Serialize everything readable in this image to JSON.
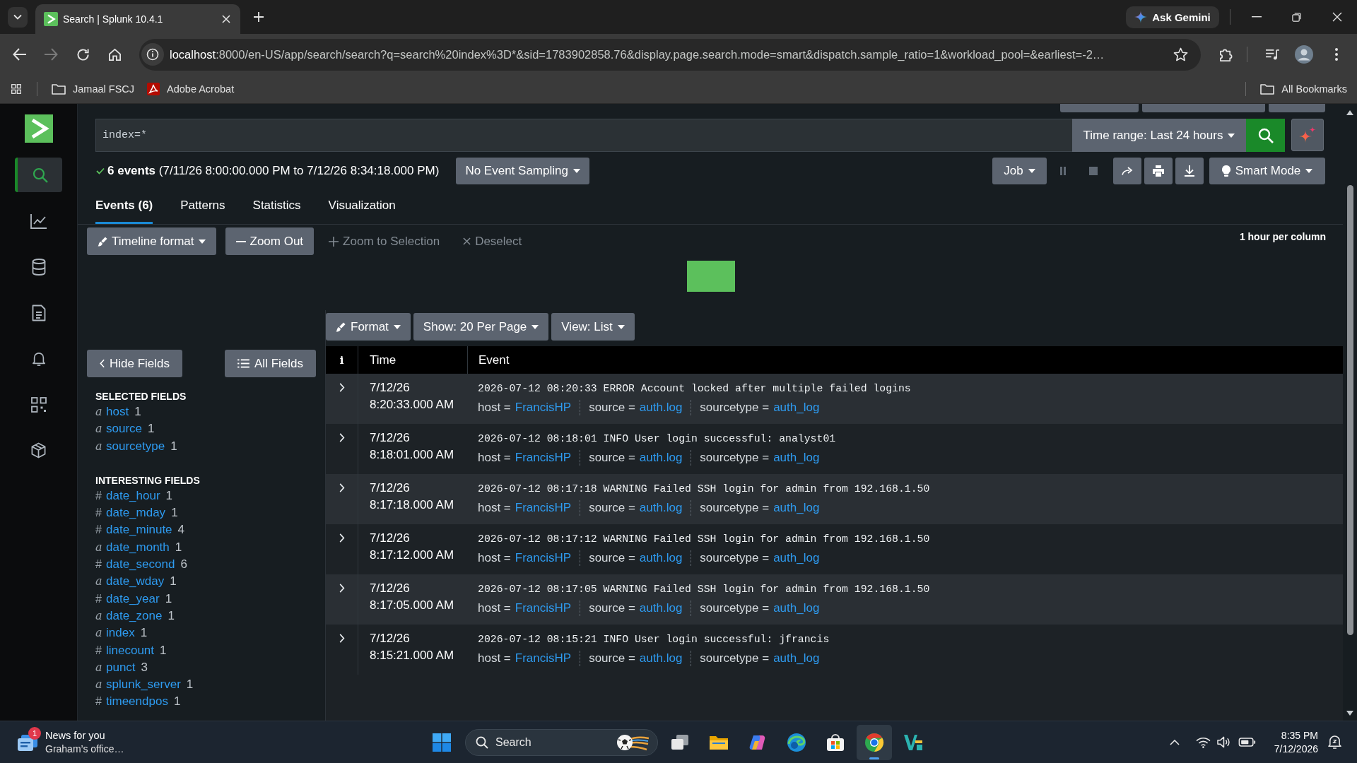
{
  "browser": {
    "tabs": [
      {
        "title": "Search | Splunk 10.4.1",
        "selected": true
      }
    ],
    "gemini": "Ask Gemini",
    "forward": {
      "disabled": true
    },
    "address": {
      "host": "localhost",
      "rest": ":8000/en-US/app/search/search?q=search%20index%3D*&sid=1783902858.76&display.page.search.mode=smart&dispatch.sample_ratio=1&workload_pool=&earliest=-2…"
    },
    "bookmarks": [
      {
        "kind": "folder",
        "label": "Jamaal FSCJ"
      },
      {
        "kind": "acrobat",
        "label": "Adobe Acrobat"
      }
    ],
    "all_bookmarks": "All Bookmarks"
  },
  "splunk": {
    "search": {
      "query": "index=*",
      "time_range": "Time range: Last 24 hours"
    },
    "status": {
      "summary": "**6 events** (7/11/26 8:00:00.000 PM to 7/12/26 8:34:18.000 PM)",
      "sampling": "No Event Sampling"
    },
    "job": {
      "label": "Job",
      "controls": [
        {
          "kind": "pause",
          "disabled": true
        },
        {
          "kind": "stop",
          "disabled": true
        },
        {
          "kind": "share",
          "disabled": false
        },
        {
          "kind": "print",
          "disabled": false
        },
        {
          "kind": "export",
          "disabled": false
        }
      ],
      "mode": "Smart Mode"
    },
    "tabs": [
      {
        "label": "Events (6)",
        "selected": true
      },
      {
        "label": "Patterns",
        "selected": false
      },
      {
        "label": "Statistics",
        "selected": false
      },
      {
        "label": "Visualization",
        "selected": false
      }
    ],
    "timeline": {
      "buttons": [
        {
          "kind": "format",
          "label": "Timeline format",
          "dropdown": true,
          "disabled": false
        },
        {
          "kind": "zoom_out",
          "label": "Zoom Out",
          "dropdown": false,
          "disabled": false
        },
        {
          "kind": "zoom_in",
          "label": "Zoom to Selection",
          "dropdown": false,
          "disabled": true
        },
        {
          "kind": "deselect",
          "label": "Deselect",
          "dropdown": false,
          "disabled": true
        }
      ],
      "scale": "1 hour per column"
    },
    "results_controls": [
      {
        "kind": "format",
        "label": "Format",
        "dropdown": true
      },
      {
        "kind": "count",
        "label": "Show: 20 Per Page",
        "dropdown": true
      },
      {
        "kind": "view",
        "label": "View: List",
        "dropdown": true
      }
    ],
    "fields": {
      "hide": "Hide Fields",
      "all": "All Fields",
      "sections": [
        {
          "title": "SELECTED FIELDS",
          "items": [
            {
              "kind": "string",
              "glyph": "a",
              "name": "host",
              "count": "1"
            },
            {
              "kind": "string",
              "glyph": "a",
              "name": "source",
              "count": "1"
            },
            {
              "kind": "string",
              "glyph": "a",
              "name": "sourcetype",
              "count": "1"
            }
          ]
        },
        {
          "title": "INTERESTING FIELDS",
          "items": [
            {
              "kind": "number",
              "glyph": "#",
              "name": "date_hour",
              "count": "1"
            },
            {
              "kind": "number",
              "glyph": "#",
              "name": "date_mday",
              "count": "1"
            },
            {
              "kind": "number",
              "glyph": "#",
              "name": "date_minute",
              "count": "4"
            },
            {
              "kind": "string",
              "glyph": "a",
              "name": "date_month",
              "count": "1"
            },
            {
              "kind": "number",
              "glyph": "#",
              "name": "date_second",
              "count": "6"
            },
            {
              "kind": "string",
              "glyph": "a",
              "name": "date_wday",
              "count": "1"
            },
            {
              "kind": "number",
              "glyph": "#",
              "name": "date_year",
              "count": "1"
            },
            {
              "kind": "string",
              "glyph": "a",
              "name": "date_zone",
              "count": "1"
            },
            {
              "kind": "string",
              "glyph": "a",
              "name": "index",
              "count": "1"
            },
            {
              "kind": "number",
              "glyph": "#",
              "name": "linecount",
              "count": "1"
            },
            {
              "kind": "string",
              "glyph": "a",
              "name": "punct",
              "count": "3"
            },
            {
              "kind": "string",
              "glyph": "a",
              "name": "splunk_server",
              "count": "1"
            },
            {
              "kind": "number",
              "glyph": "#",
              "name": "timeendpos",
              "count": "1"
            }
          ]
        }
      ]
    },
    "events": {
      "columns": [
        "i",
        "Time",
        "Event"
      ],
      "rows": [
        {
          "date": "7/12/26",
          "time": "8:20:33.000 AM",
          "raw": "2026-07-12 08:20:33 ERROR Account locked after multiple failed logins",
          "fields": [
            {
              "label": "host =",
              "value": "FrancisHP"
            },
            {
              "label": "source =",
              "value": "auth.log"
            },
            {
              "label": "sourcetype =",
              "value": "auth_log"
            }
          ]
        },
        {
          "date": "7/12/26",
          "time": "8:18:01.000 AM",
          "raw": "2026-07-12 08:18:01 INFO User login successful: analyst01",
          "fields": [
            {
              "label": "host =",
              "value": "FrancisHP"
            },
            {
              "label": "source =",
              "value": "auth.log"
            },
            {
              "label": "sourcetype =",
              "value": "auth_log"
            }
          ]
        },
        {
          "date": "7/12/26",
          "time": "8:17:18.000 AM",
          "raw": "2026-07-12 08:17:18 WARNING Failed SSH login for admin from 192.168.1.50",
          "fields": [
            {
              "label": "host =",
              "value": "FrancisHP"
            },
            {
              "label": "source =",
              "value": "auth.log"
            },
            {
              "label": "sourcetype =",
              "value": "auth_log"
            }
          ]
        },
        {
          "date": "7/12/26",
          "time": "8:17:12.000 AM",
          "raw": "2026-07-12 08:17:12 WARNING Failed SSH login for admin from 192.168.1.50",
          "fields": [
            {
              "label": "host =",
              "value": "FrancisHP"
            },
            {
              "label": "source =",
              "value": "auth.log"
            },
            {
              "label": "sourcetype =",
              "value": "auth_log"
            }
          ]
        },
        {
          "date": "7/12/26",
          "time": "8:17:05.000 AM",
          "raw": "2026-07-12 08:17:05 WARNING Failed SSH login for admin from 192.168.1.50",
          "fields": [
            {
              "label": "host =",
              "value": "FrancisHP"
            },
            {
              "label": "source =",
              "value": "auth.log"
            },
            {
              "label": "sourcetype =",
              "value": "auth_log"
            }
          ]
        },
        {
          "date": "7/12/26",
          "time": "8:15:21.000 AM",
          "raw": "2026-07-12 08:15:21 INFO User login successful: jfrancis",
          "fields": [
            {
              "label": "host =",
              "value": "FrancisHP"
            },
            {
              "label": "source =",
              "value": "auth.log"
            },
            {
              "label": "sourcetype =",
              "value": "auth_log"
            }
          ]
        }
      ]
    }
  },
  "taskbar": {
    "news": {
      "title": "News for you",
      "subtitle": "Graham’s office…",
      "badge": "1"
    },
    "search": {
      "label": "Search"
    },
    "apps": [
      {
        "kind": "task_view",
        "active": false
      },
      {
        "kind": "explorer",
        "active": false
      },
      {
        "kind": "copilot",
        "active": false
      },
      {
        "kind": "edge",
        "active": false
      },
      {
        "kind": "store",
        "active": false
      },
      {
        "kind": "chrome",
        "active": true
      },
      {
        "kind": "app",
        "active": false
      }
    ],
    "clock": {
      "time": "8:35 PM",
      "date": "7/12/2026"
    }
  }
}
